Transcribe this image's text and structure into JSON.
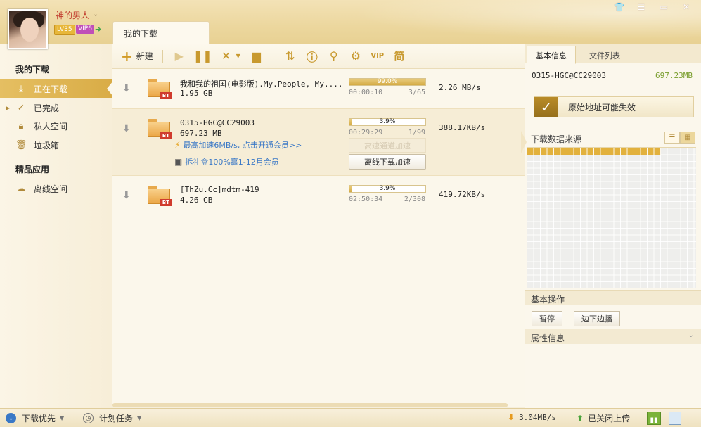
{
  "user": {
    "name": "神的男人",
    "level": "LV35",
    "vip": "VIP6"
  },
  "window_controls": [
    "skin-icon",
    "menu-icon",
    "minimize-icon",
    "close-icon"
  ],
  "main_tab": "我的下载",
  "sidebar": {
    "my_downloads": "我的下载",
    "items": [
      {
        "label": "正在下载",
        "icon": "download-icon",
        "active": true
      },
      {
        "label": "已完成",
        "icon": "check-icon",
        "active": false
      },
      {
        "label": "私人空间",
        "icon": "lock-icon",
        "active": false
      },
      {
        "label": "垃圾箱",
        "icon": "trash-icon",
        "active": false
      }
    ],
    "apps_header": "精品应用",
    "apps": [
      {
        "label": "离线空间",
        "icon": "cloud-icon"
      }
    ]
  },
  "toolbar": {
    "new_label": "新建",
    "buttons": [
      "play-icon",
      "pause-icon",
      "delete-icon",
      "folder-icon",
      "sort-icon",
      "info-icon",
      "search-icon",
      "gear-icon",
      "vip-icon",
      "simplified-icon"
    ],
    "simplified_glyph": "简",
    "vip_glyph": "VIP"
  },
  "tasks": [
    {
      "name": "我和我的祖国(电影版).My.People, My....",
      "size": "1.95 GB",
      "progress": 99.0,
      "progress_text": "99.0%",
      "time": "00:00:10",
      "pieces": "3/65",
      "speed": "2.26  MB/s",
      "badge": "BT"
    },
    {
      "name": "0315-HGC@CC29003",
      "size": "697.23 MB",
      "progress": 3.9,
      "progress_text": "3.9%",
      "time": "00:29:29",
      "pieces": "1/99",
      "speed": "388.17KB/s",
      "badge": "BT",
      "promo1": "最高加速6MB/s, 点击开通会员>>",
      "promo2": "拆礼盒100%赢1-12月会员",
      "ghost_button": "高速通道加速",
      "offline_button": "离线下载加速"
    },
    {
      "name": "[ThZu.Cc]mdtm-419",
      "size": "4.26 GB",
      "progress": 3.9,
      "progress_text": "3.9%",
      "time": "02:50:34",
      "pieces": "2/308",
      "speed": "419.72KB/s",
      "badge": "BT"
    }
  ],
  "right_panel": {
    "tabs": [
      "基本信息",
      "文件列表"
    ],
    "file_name": "0315-HGC@CC29003",
    "file_size": "697.23MB",
    "alert": "原始地址可能失效",
    "sources_title": "下载数据来源",
    "basic_ops": "基本操作",
    "pause_btn": "暂停",
    "play_while_btn": "边下边播",
    "props": "属性信息"
  },
  "statusbar": {
    "priority": "下载优先",
    "schedule": "计划任务",
    "down_speed": "3.04MB/s",
    "upload": "已关闭上传"
  }
}
